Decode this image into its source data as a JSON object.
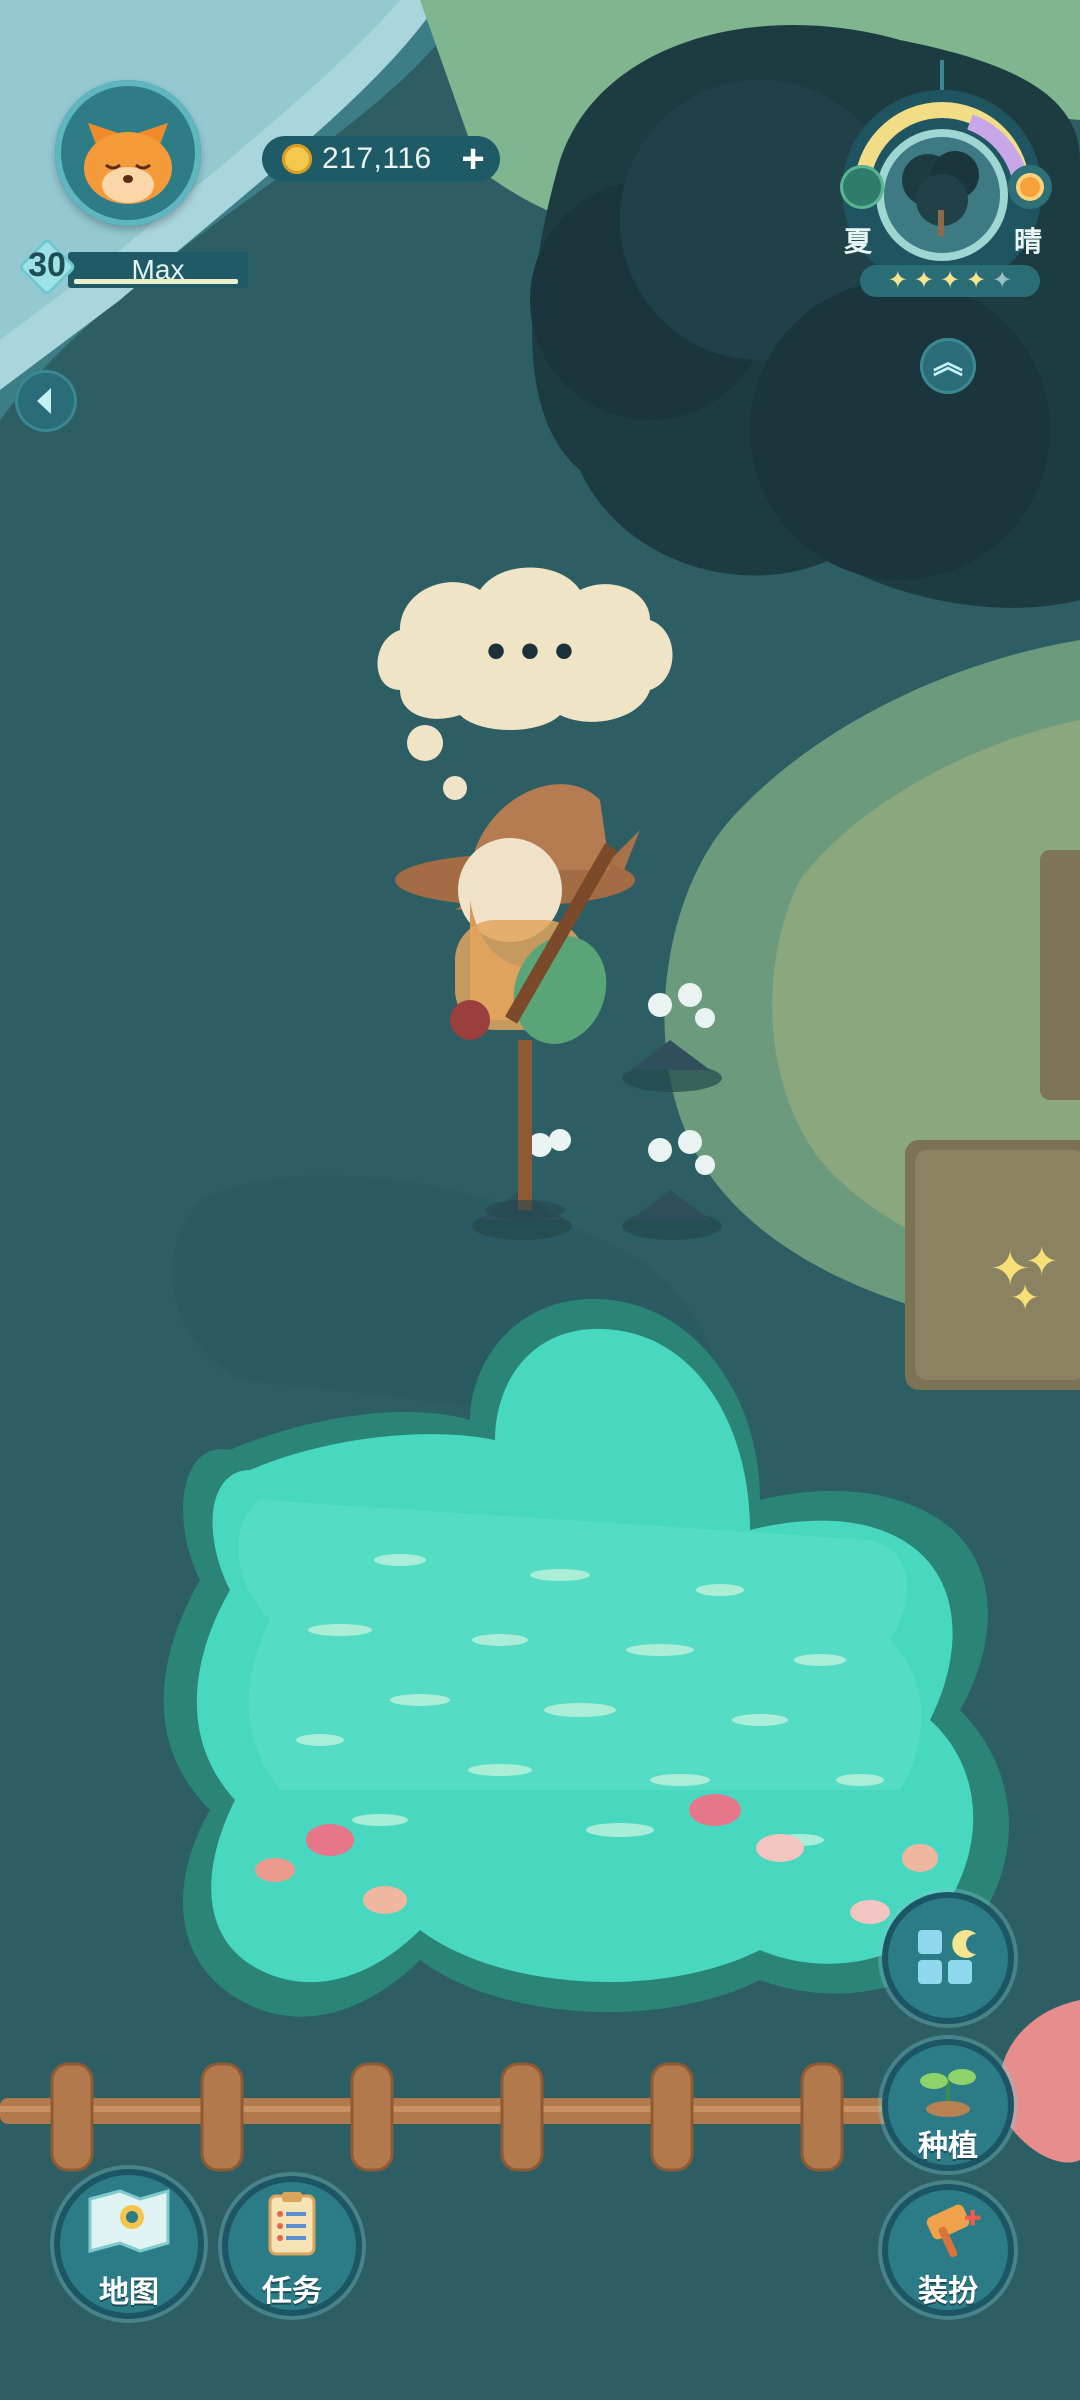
{
  "player": {
    "name": "Max",
    "level": "30",
    "xp_fraction": 0.95
  },
  "currency": {
    "coins": "217,116",
    "add_label": "+"
  },
  "season": {
    "season_label": "夏",
    "weather_label": "晴",
    "stars_filled": 4,
    "stars_total": 5
  },
  "scene": {
    "thought_bubble_text": "• • •"
  },
  "buttons": {
    "map_label": "地图",
    "tasks_label": "任务",
    "plant_label": "种植",
    "dressup_label": "装扮"
  },
  "colors": {
    "water": "#2d5e64",
    "pond": "#48d8c0",
    "hud_dark": "#1f5a67",
    "accent_light": "#f6e48e"
  },
  "icons": {
    "avatar": "fox-avatar-icon",
    "coin": "coin-icon",
    "back": "chevron-left-icon",
    "season": "leaf-icon",
    "weather": "sun-icon",
    "expand": "double-chevron-up-icon",
    "map": "map-icon",
    "tasks": "clipboard-icon",
    "plant": "sprout-icon",
    "dressup": "hammer-icon",
    "grid": "grid-moon-icon"
  }
}
